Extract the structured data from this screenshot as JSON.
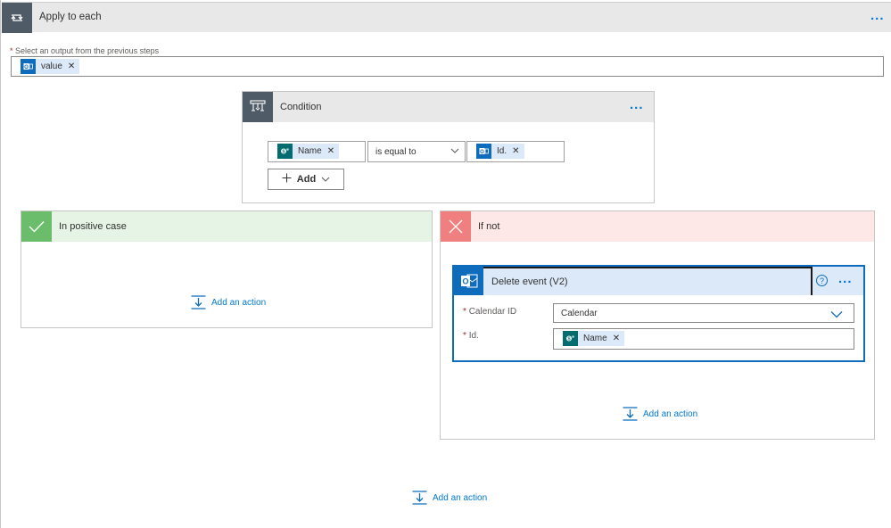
{
  "apply_to_each": {
    "title": "Apply to each",
    "more": "...",
    "select_label": "Select an output from the previous steps",
    "required_mark": "*",
    "token": "value"
  },
  "condition": {
    "title": "Condition",
    "more": "...",
    "left_token": "Name",
    "operator": "is equal to",
    "right_token": "Id.",
    "add_label": "Add"
  },
  "positive": {
    "title": "In positive case",
    "add_action": "Add an action"
  },
  "negative": {
    "title": "If not",
    "add_action": "Add an action",
    "action": {
      "title": "Delete event (V2)",
      "help": "?",
      "more": "...",
      "calendar_label": "Calendar ID",
      "calendar_value": "Calendar",
      "id_label": "Id.",
      "id_token": "Name"
    }
  },
  "bottom": {
    "add_action": "Add an action"
  },
  "colors": {
    "accent": "#0078d4",
    "positive_header": "#e5f4e5",
    "positive_icon": "#6bbd6b",
    "negative_header": "#fde7e7",
    "negative_icon": "#f08080",
    "outlook_blue": "#0f6cbd",
    "sharepoint_teal": "#036c70"
  }
}
